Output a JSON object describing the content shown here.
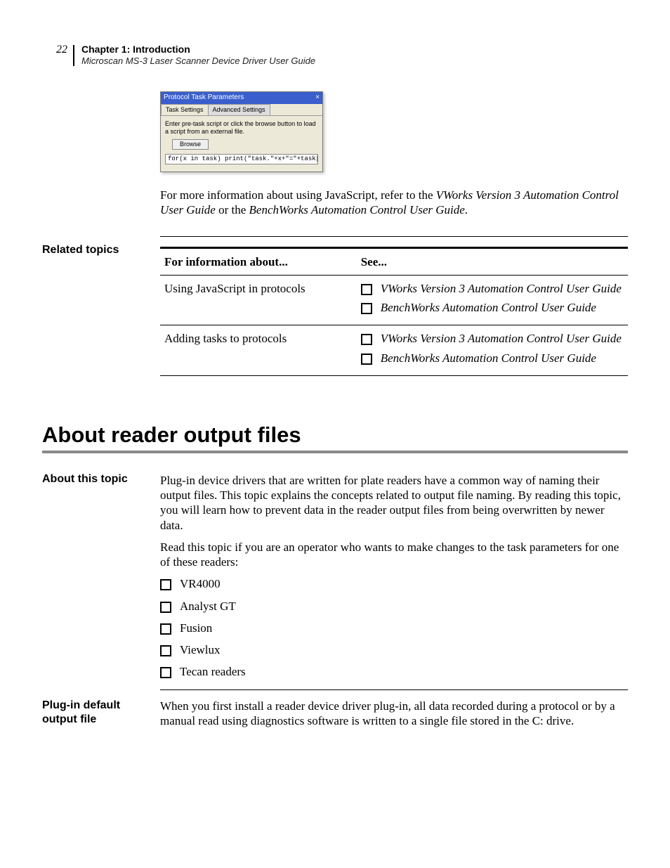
{
  "page_number": "22",
  "header": {
    "chapter": "Chapter 1: Introduction",
    "guide": "Microscan MS-3 Laser Scanner Device Driver User Guide"
  },
  "screenshot": {
    "title": "Protocol Task Parameters",
    "close": "×",
    "tab_active": "Task Settings",
    "tab_inactive": "Advanced Settings",
    "instructions": "Enter pre-task script or click the browse button to load a script from an external file.",
    "browse_btn": "Browse",
    "code": "for(x in task) print(\"task.\"+x+\"=\"+task[x])"
  },
  "js_paragraph": {
    "pre": "For more information about using JavaScript, refer to the ",
    "ref1": "VWorks Version 3 Automation Control User Guide",
    "mid": " or the ",
    "ref2": "BenchWorks Automation Control User Guide",
    "post": "."
  },
  "related": {
    "sidehead": "Related topics",
    "col1": "For information about...",
    "col2": "See...",
    "rows": [
      {
        "about": "Using JavaScript in protocols",
        "see": [
          "VWorks Version 3 Automation Control User Guide",
          "BenchWorks Automation Control User Guide"
        ]
      },
      {
        "about": "Adding tasks to protocols",
        "see": [
          "VWorks Version 3 Automation Control User Guide",
          "BenchWorks Automation Control User Guide"
        ]
      }
    ]
  },
  "section_title": "About reader output files",
  "about_topic": {
    "sidehead": "About this topic",
    "p1": "Plug-in device drivers that are written for plate readers have a common way of naming their output files. This topic explains the concepts related to output file naming. By reading this topic, you will learn how to prevent data in the reader output files from being overwritten by newer data.",
    "p2": "Read this topic if you are an operator who wants to make changes to the task parameters for one of these readers:",
    "readers": [
      "VR4000",
      "Analyst GT",
      "Fusion",
      "Viewlux",
      "Tecan readers"
    ]
  },
  "plugin_default": {
    "sidehead": "Plug-in default output file",
    "p": "When you first install a reader device driver plug-in, all data recorded during a protocol or by a manual read using diagnostics software is written to a single file stored in the C: drive."
  }
}
